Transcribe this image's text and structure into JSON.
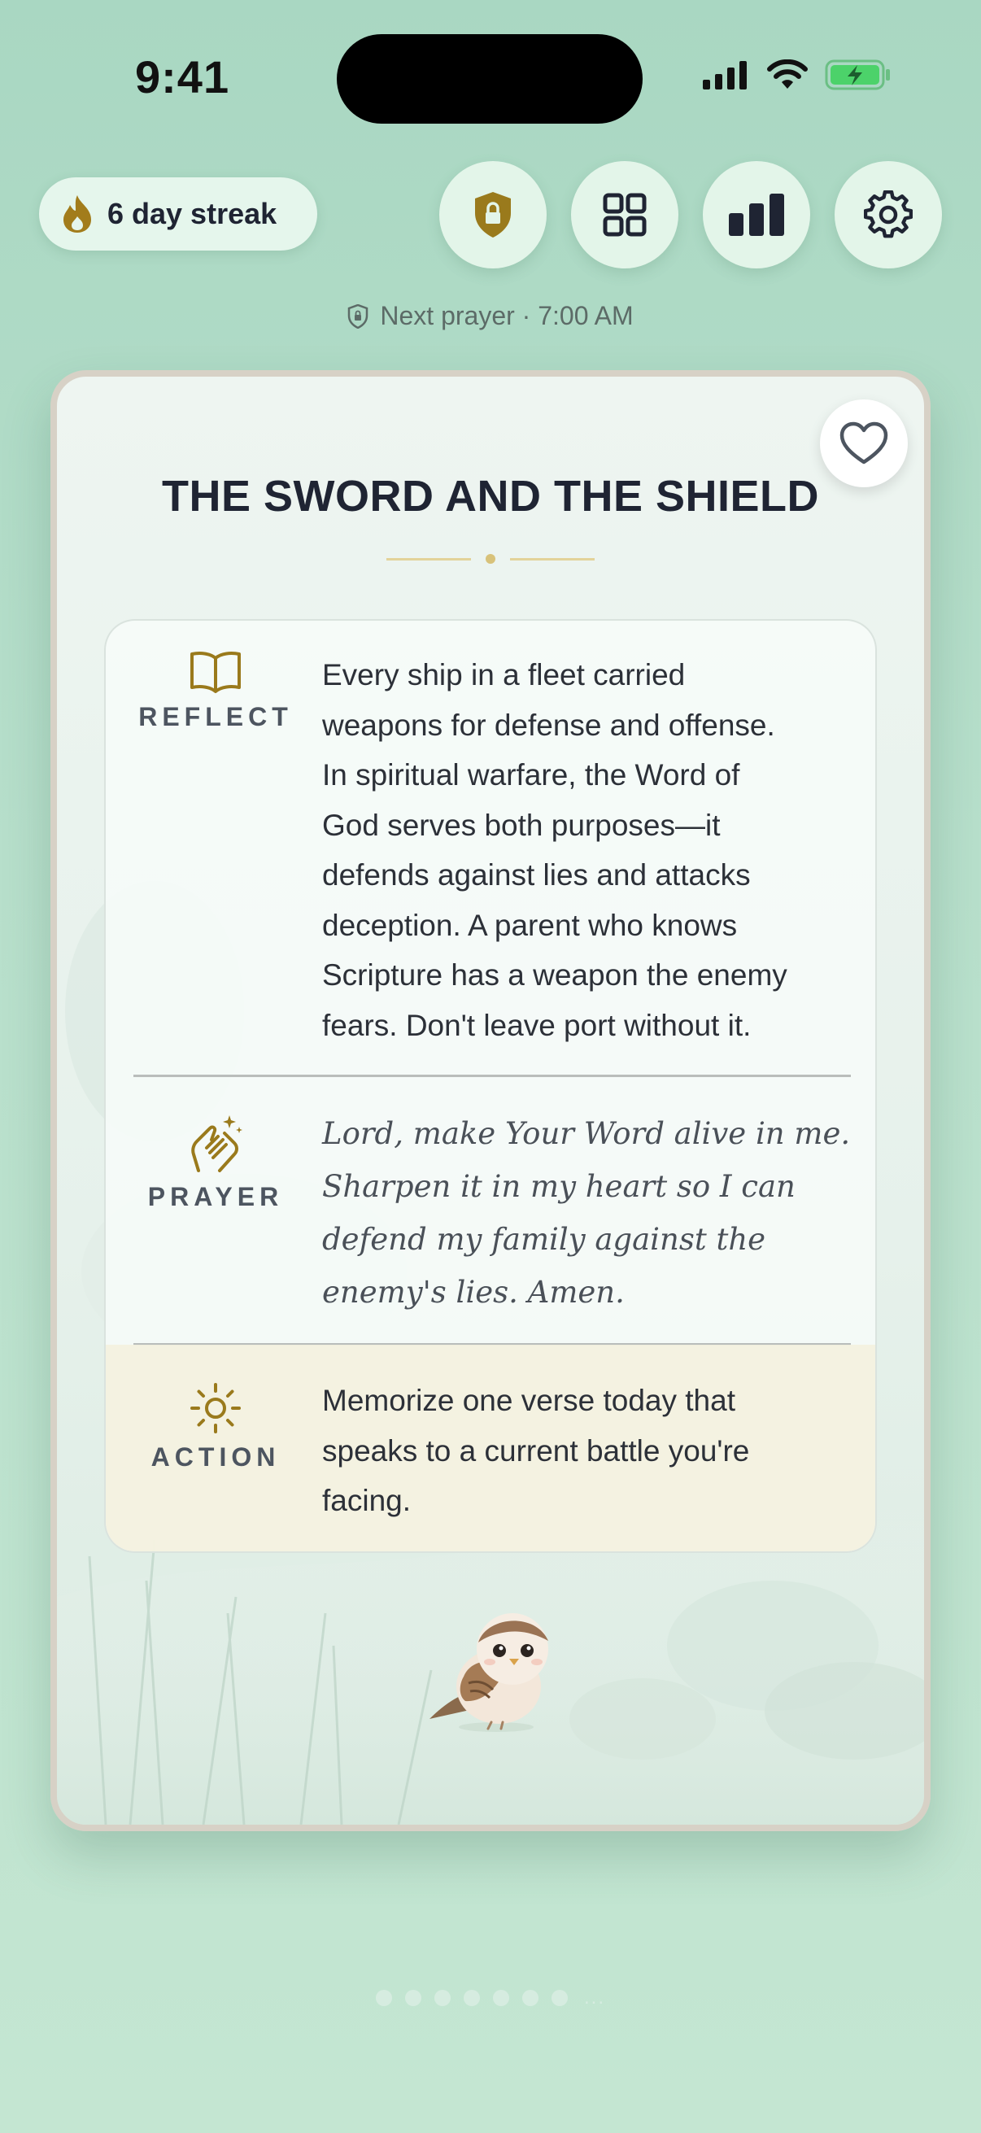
{
  "status_bar": {
    "time": "9:41"
  },
  "header": {
    "streak_label": "6 day streak",
    "buttons": [
      {
        "icon": "shield-lock-icon"
      },
      {
        "icon": "grid-icon"
      },
      {
        "icon": "bar-chart-icon"
      },
      {
        "icon": "gear-icon"
      }
    ],
    "next_prayer": "Next prayer · 7:00 AM"
  },
  "card": {
    "title": "THE SWORD AND THE SHIELD",
    "favorite_icon": "heart-icon",
    "sections": {
      "reflect": {
        "label": "REFLECT",
        "icon": "open-book-icon",
        "lines": [
          "Every ship in a fleet carried",
          "weapons for defense and offense.",
          "In spiritual warfare, the Word of",
          "God serves both purposes—it",
          "defends against lies and attacks",
          "deception. A parent who knows",
          "Scripture has a weapon the enemy",
          "fears. Don't leave port without it."
        ]
      },
      "prayer": {
        "label": "PRAYER",
        "icon": "praying-hands-icon",
        "lines": [
          "Lord, make Your Word alive in me.",
          "Sharpen it in my heart so I can",
          "defend my family against the",
          "enemy's lies. Amen."
        ]
      },
      "action": {
        "label": "ACTION",
        "icon": "sun-icon",
        "lines": [
          "Memorize one verse today that",
          "speaks to a current battle you're",
          "facing."
        ]
      }
    }
  },
  "pagination": {
    "dot_count": 7,
    "overflow": "..."
  },
  "colors": {
    "accent_gold": "#9a7a1c",
    "background": "#b7dfcb"
  }
}
